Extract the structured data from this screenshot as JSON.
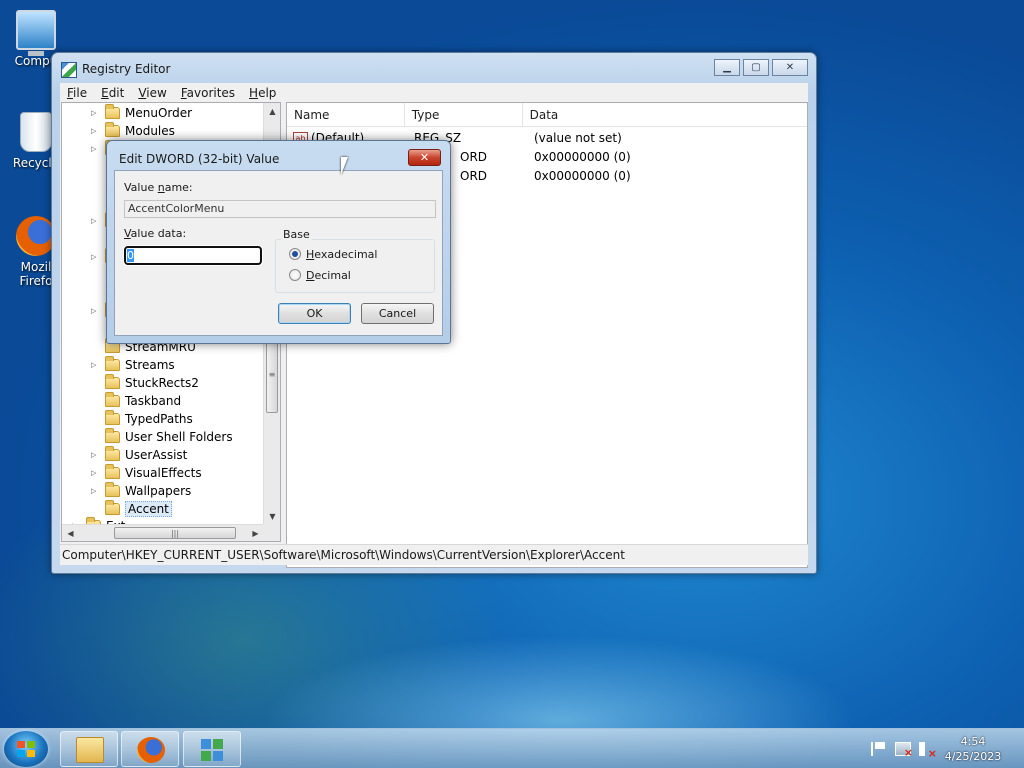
{
  "desktop": {
    "icons": [
      {
        "label": "Compu"
      },
      {
        "label": "Recycle"
      },
      {
        "label": "Mozil",
        "label2": "Firefo"
      }
    ]
  },
  "regedit": {
    "title": "Registry Editor",
    "menu": [
      {
        "label": "File",
        "accel": "F",
        "rest": "ile"
      },
      {
        "label": "Edit",
        "accel": "E",
        "rest": "dit"
      },
      {
        "label": "View",
        "accel": "V",
        "rest": "iew"
      },
      {
        "label": "Favorites",
        "accel": "F",
        "rest": "avorites"
      },
      {
        "label": "Help",
        "accel": "H",
        "rest": "elp"
      }
    ],
    "tree": {
      "items": [
        {
          "label": "MenuOrder",
          "expandable": true
        },
        {
          "label": "Modules",
          "expandable": true
        },
        {
          "label": "StreamMRU",
          "expandable": false
        },
        {
          "label": "Streams",
          "expandable": true
        },
        {
          "label": "StuckRects2",
          "expandable": false
        },
        {
          "label": "Taskband",
          "expandable": false
        },
        {
          "label": "TypedPaths",
          "expandable": false
        },
        {
          "label": "User Shell Folders",
          "expandable": false
        },
        {
          "label": "UserAssist",
          "expandable": true
        },
        {
          "label": "VisualEffects",
          "expandable": true
        },
        {
          "label": "Wallpapers",
          "expandable": true
        },
        {
          "label": "Accent",
          "expandable": false,
          "selected": true
        },
        {
          "label": "Ext",
          "expandable": true
        }
      ]
    },
    "list": {
      "columns": [
        "Name",
        "Type",
        "Data"
      ],
      "rows": [
        {
          "name": "(Default)",
          "type": "REG_SZ",
          "data": "(value not set)"
        },
        {
          "name": "",
          "type": "ORD",
          "data": "0x00000000 (0)"
        },
        {
          "name": "",
          "type": "ORD",
          "data": "0x00000000 (0)"
        }
      ]
    },
    "status": "Computer\\HKEY_CURRENT_USER\\Software\\Microsoft\\Windows\\CurrentVersion\\Explorer\\Accent"
  },
  "dialog": {
    "title": "Edit DWORD (32-bit) Value",
    "close_glyph": "✕",
    "value_name_label": {
      "pre": "Value ",
      "accel": "n",
      "post": "ame:"
    },
    "value_name": "AccentColorMenu",
    "value_data_label": {
      "pre": "",
      "accel": "V",
      "post": "alue data:"
    },
    "value_data": "0",
    "base_label": "Base",
    "radios": [
      {
        "accel": "H",
        "rest": "exadecimal",
        "checked": true
      },
      {
        "accel": "D",
        "rest": "ecimal",
        "checked": false
      }
    ],
    "ok_label": "OK",
    "cancel_label": "Cancel"
  },
  "taskbar": {
    "time": "4:54",
    "date": "4/25/2023"
  },
  "icons": {
    "start": "windows-logo-icon",
    "explorer": "folder-icon",
    "browser": "firefox-icon",
    "regedit": "regedit-icon"
  }
}
